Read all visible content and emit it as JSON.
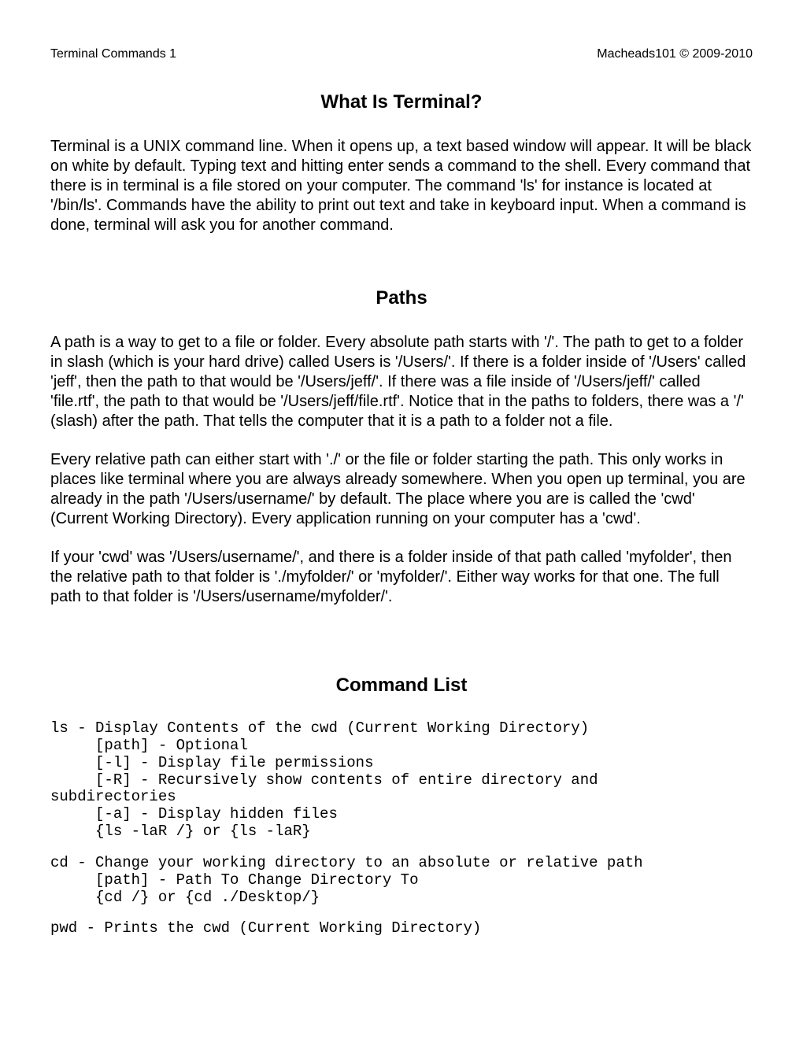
{
  "header": {
    "left": "Terminal Commands 1",
    "right": "Macheads101 © 2009-2010"
  },
  "sections": {
    "s1": {
      "title": "What Is Terminal?",
      "p1": "Terminal is a UNIX command line.  When it opens up, a text based window will appear.  It will be black on white by default.  Typing text and hitting enter sends a command to the shell.  Every command that there is in terminal is a file stored on your computer.  The command 'ls' for instance is located at '/bin/ls'.  Commands have the ability to print out text and take in keyboard input.  When a command is done, terminal will ask you for another command."
    },
    "s2": {
      "title": "Paths",
      "p1": "A path is a way to get to a file or folder.  Every absolute path starts with '/'.  The path to get to a folder in slash (which is your hard drive) called Users is '/Users/'.  If there is a folder inside of '/Users' called 'jeff', then the path to that would be '/Users/jeff/'.  If there was a file inside of '/Users/jeff/' called 'file.rtf', the path to that would be '/Users/jeff/file.rtf'.  Notice that in the paths to folders, there was a '/' (slash) after the path.  That tells the computer that it is a path to a folder not a file.",
      "p2": "Every relative path can either start with './' or the file or folder starting the path.  This only works in places like terminal where you are always already somewhere.  When you open up terminal, you are already in the path '/Users/username/' by default.  The place where you are is called the 'cwd' (Current Working Directory).  Every application running on your computer has a 'cwd'.",
      "p3": "If your 'cwd' was '/Users/username/', and there is a folder inside of that path called 'myfolder', then the relative path to that folder is './myfolder/' or 'myfolder/'.  Either way works for that one.  The full path to that folder is '/Users/username/myfolder/'."
    },
    "s3": {
      "title": "Command List",
      "cmd_ls": "ls - Display Contents of the cwd (Current Working Directory)\n     [path] - Optional\n     [-l] - Display file permissions\n     [-R] - Recursively show contents of entire directory and\nsubdirectories\n     [-a] - Display hidden files\n     {ls -laR /} or {ls -laR}",
      "cmd_cd": "cd - Change your working directory to an absolute or relative path\n     [path] - Path To Change Directory To\n     {cd /} or {cd ./Desktop/}",
      "cmd_pwd": "pwd - Prints the cwd (Current Working Directory)"
    }
  }
}
